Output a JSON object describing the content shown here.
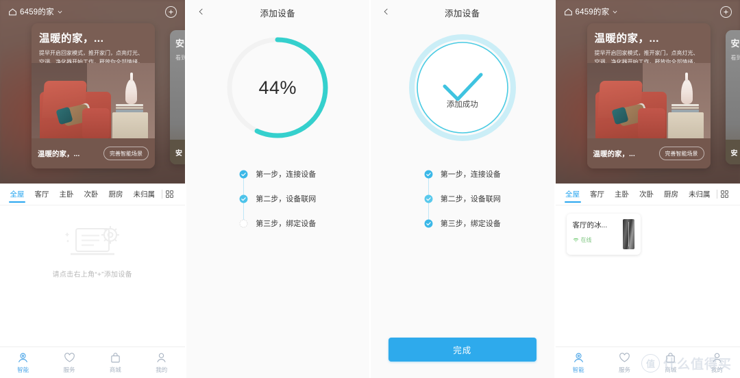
{
  "home": {
    "house_icon": "home-icon",
    "title": "6459的家",
    "chevron": "chevron-down-icon",
    "add_button": "plus-icon",
    "scene_card": {
      "heading": "温暖的家，...",
      "body": "提早开启回家模式，推开家门，点亮灯光、空调、净化器开始工作，释放你全部情绪，给你暖暖的家",
      "footer_title": "温暖的家，...",
      "footer_button": "完善智能场景"
    },
    "scene_card_2": {
      "heading": "安",
      "body": "看到\n安全\n不",
      "footer_title": "安"
    },
    "tabs": [
      {
        "label": "全屋",
        "active": true
      },
      {
        "label": "客厅",
        "active": false
      },
      {
        "label": "主卧",
        "active": false
      },
      {
        "label": "次卧",
        "active": false
      },
      {
        "label": "厨房",
        "active": false
      },
      {
        "label": "未归属",
        "active": false
      }
    ],
    "tabs_grid_icon": "grid-view-icon",
    "empty": {
      "illustration": "laptop-gear-icon",
      "text": "请点击右上角“+”添加设备"
    },
    "devices": [
      {
        "name": "客厅的冰...",
        "status_icon": "wifi-icon",
        "status": "在线",
        "thumb": "refrigerator-thumbnail"
      }
    ],
    "bottom_nav": [
      {
        "label": "智能",
        "icon": "smart-icon",
        "active": true
      },
      {
        "label": "服务",
        "icon": "heart-icon",
        "active": false
      },
      {
        "label": "商城",
        "icon": "shop-bag-icon",
        "active": false
      },
      {
        "label": "我的",
        "icon": "person-icon",
        "active": false
      }
    ]
  },
  "add_progress": {
    "back_icon": "back-chevron-icon",
    "title": "添加设备",
    "percent_label": "44%",
    "percent_value": 44,
    "arc_color": "#35d0cd",
    "track_color": "#f1f1f1",
    "steps": [
      {
        "label": "第一步，连接设备",
        "done": true
      },
      {
        "label": "第二步，设备联网",
        "done": true
      },
      {
        "label": "第三步，绑定设备",
        "done": false
      }
    ]
  },
  "add_success": {
    "back_icon": "back-chevron-icon",
    "title": "添加设备",
    "check_icon": "check-icon",
    "success_text": "添加成功",
    "ring_color": "#3fc9e0",
    "halo_color": "#c9eef6",
    "steps": [
      {
        "label": "第一步，连接设备",
        "done": true
      },
      {
        "label": "第二步，设备联网",
        "done": true
      },
      {
        "label": "第三步，绑定设备",
        "done": true
      }
    ],
    "done_button": "完成",
    "done_button_color": "#2eaaec"
  },
  "watermark": {
    "badge": "值",
    "text": "什么值得买"
  }
}
